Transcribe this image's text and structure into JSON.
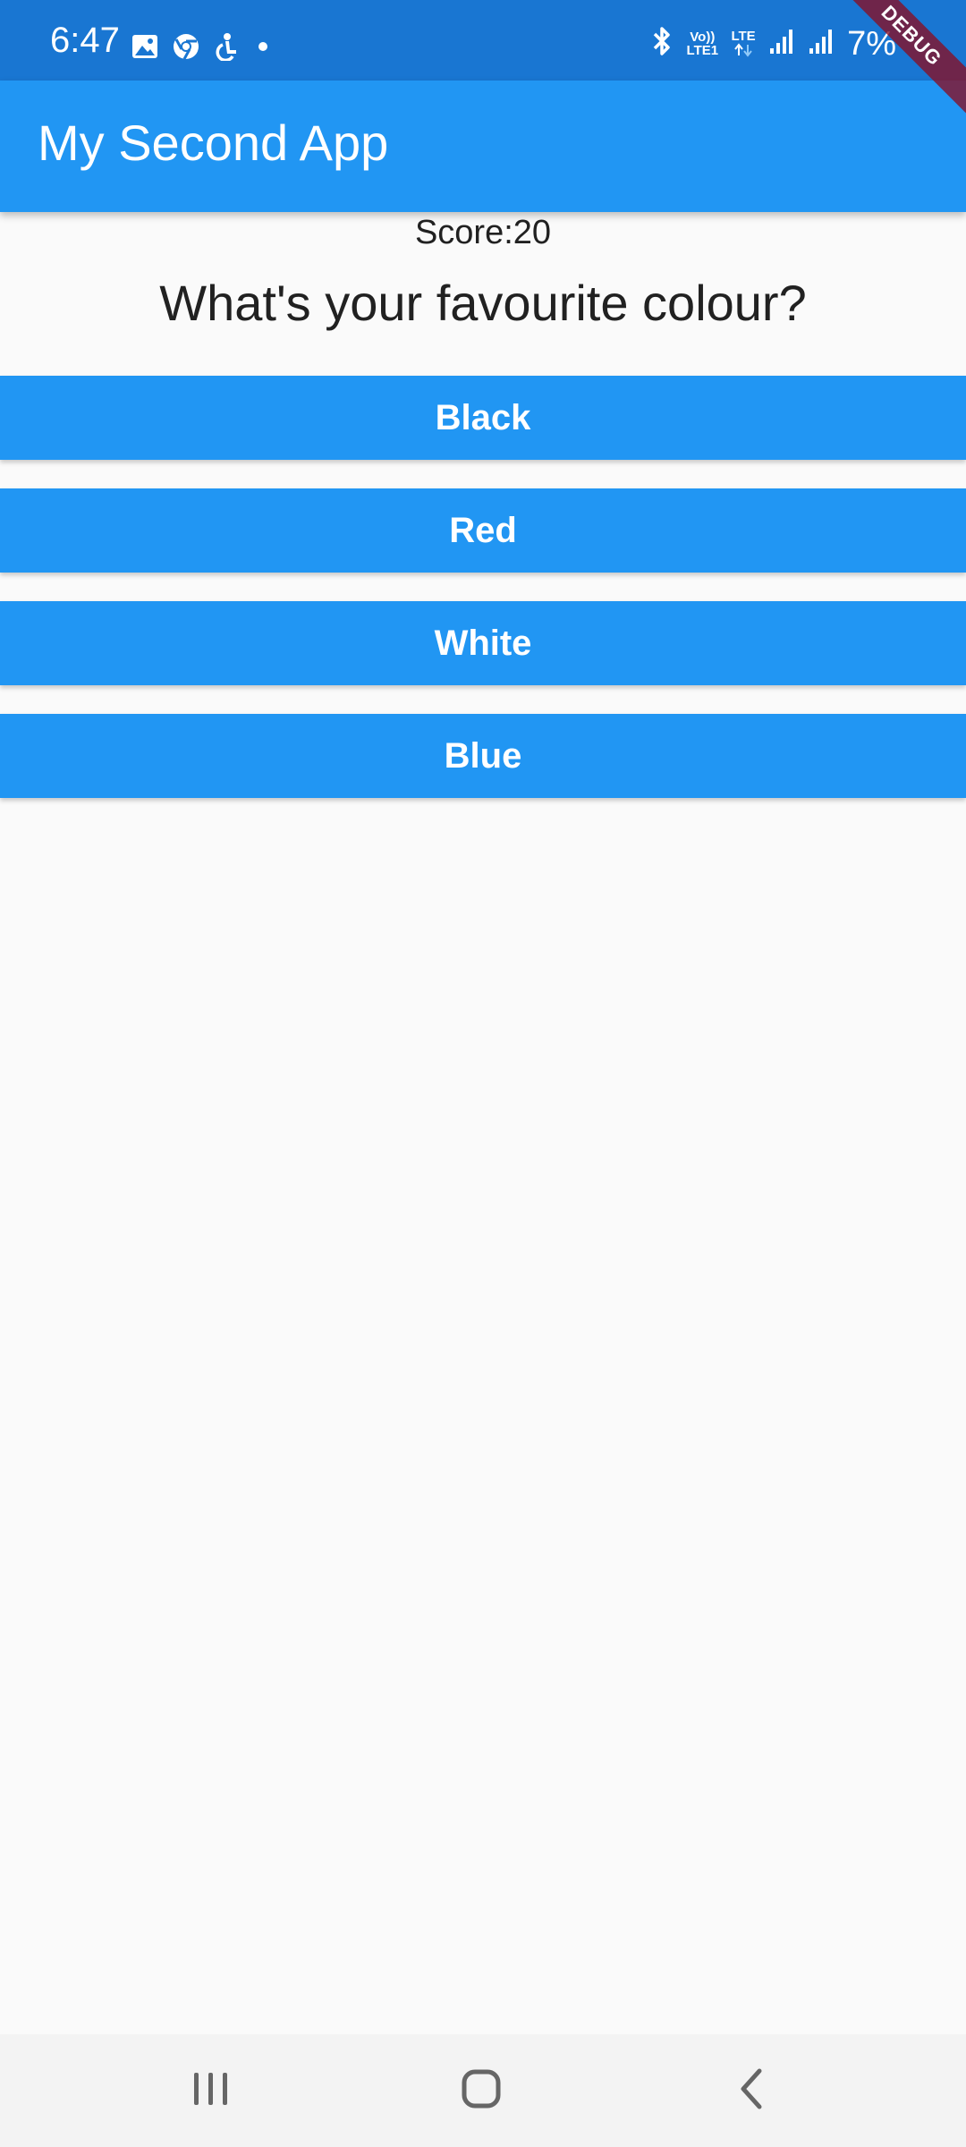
{
  "status_bar": {
    "time": "6:47",
    "battery": "7%",
    "network_top": "Vo))",
    "network_bottom": "LTE1",
    "lte_label": "LTE",
    "left_icons": [
      "gallery-icon",
      "chrome-icon",
      "accessibility-icon",
      "notification-dot-icon"
    ],
    "right_icons": [
      "bluetooth-icon",
      "volte-icon",
      "lte-icon",
      "signal-icon",
      "signal-icon"
    ]
  },
  "app_bar": {
    "title": "My Second App",
    "debug_banner": "DEBUG"
  },
  "quiz": {
    "score": "Score:20",
    "question": "What's your favourite colour?",
    "answers": [
      "Black",
      "Red",
      "White",
      "Blue"
    ]
  },
  "nav_bar": {
    "buttons": [
      "recent-apps-icon",
      "home-icon",
      "back-icon"
    ]
  },
  "colors": {
    "primary": "#2196f3",
    "status_bar": "#1976d2",
    "background": "#fafafa",
    "text": "#212121"
  }
}
